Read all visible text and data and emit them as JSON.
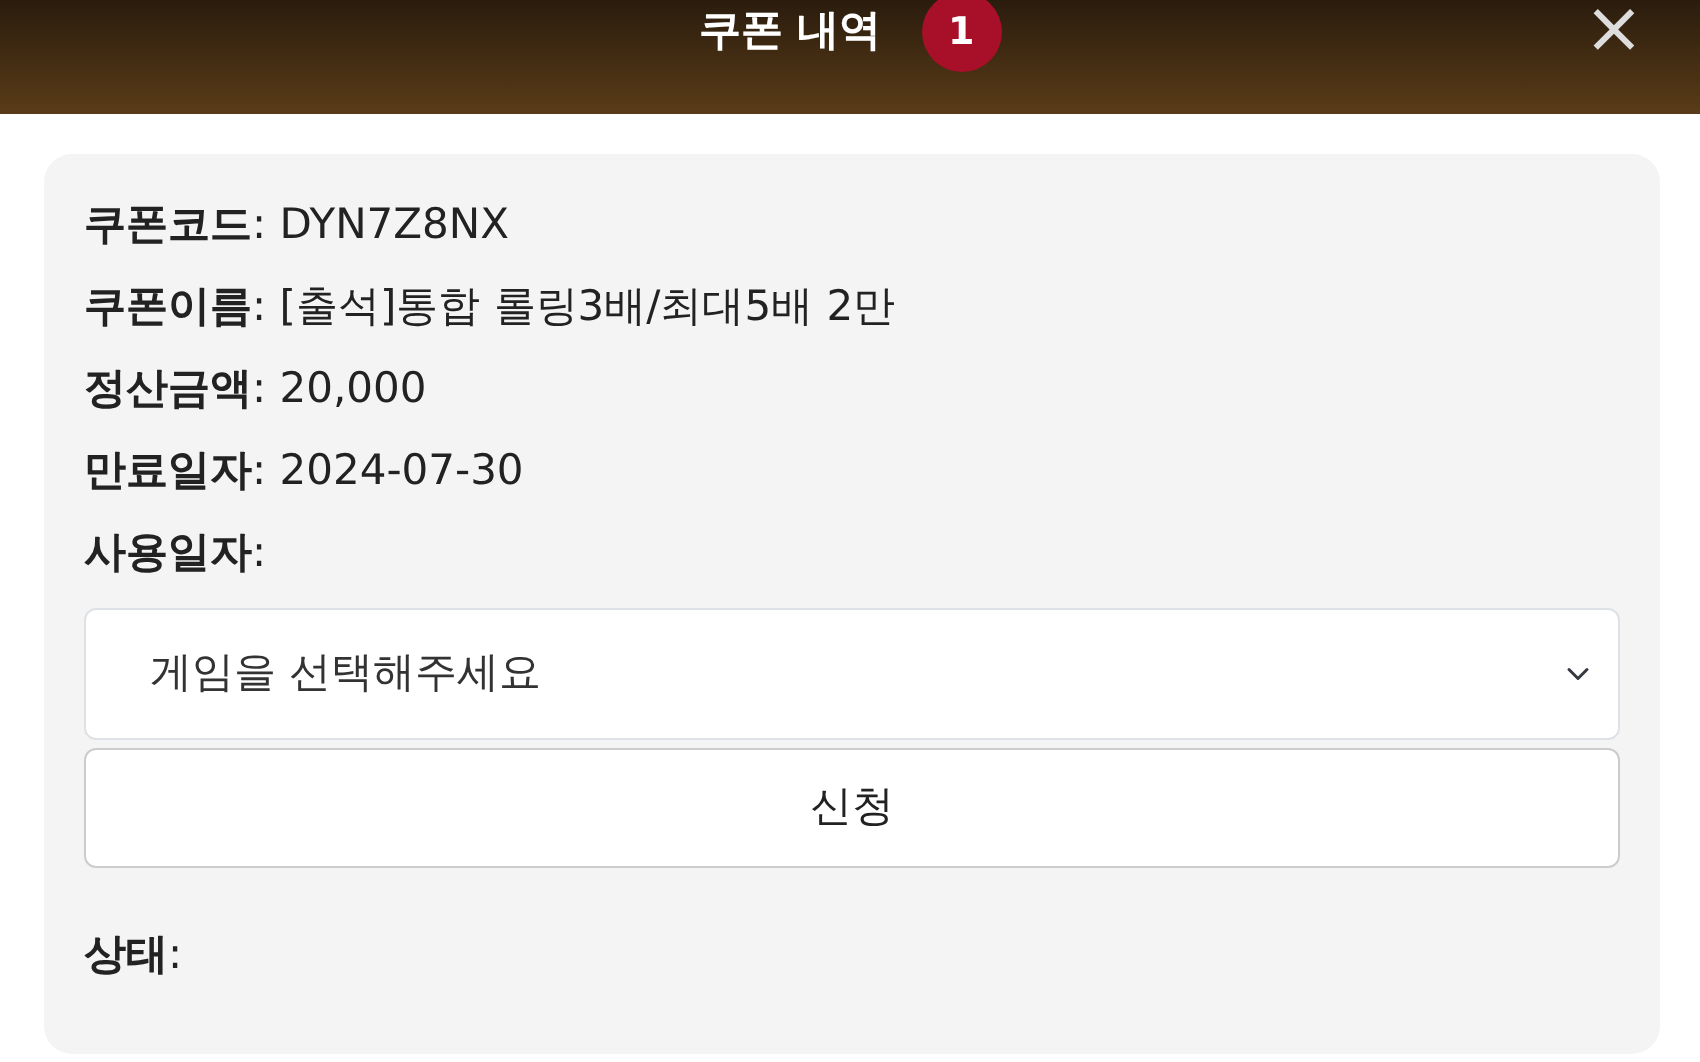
{
  "header": {
    "title": "쿠폰 내역",
    "badge": "1",
    "close": "×"
  },
  "fields": [
    {
      "text": "**쿠폰코드**: DYN7Z8NX"
    },
    {
      "text": "**쿠폰이름**: [출석]통합 롤링3배/최대5배 2만"
    },
    {
      "text": "**정산금액**: 20,000"
    },
    {
      "text": "**만료일자**: 2024-07-30"
    },
    {
      "text": "**사용일자**:"
    }
  ],
  "select": {
    "value": "게임을 선택해주세요"
  },
  "button": "신청",
  "status": {
    "text": "**상태**:"
  }
}
